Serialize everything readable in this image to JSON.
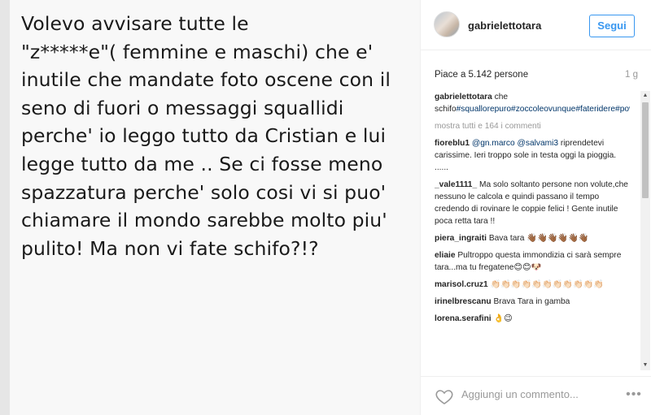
{
  "post": {
    "image_text": "Volevo avvisare tutte le\n\"z*****e\"( femmine e maschi) che e'\ninutile che mandate foto oscene con il\nseno di fuori o messaggi squallidi\nperche' io leggo tutto da Cristian e lui\nlegge tutto da me .. Se ci fosse meno\nspazzatura perche' solo cosi vi si puo'\nchiamare il mondo sarebbe molto piu'\npulito! Ma non vi fate schifo?!?"
  },
  "header": {
    "username": "gabrielettotara",
    "follow_label": "Segui",
    "accent": "#3897f0"
  },
  "likes": {
    "text": "Piace a 5.142 persone",
    "time": "1 g"
  },
  "caption": {
    "user": "gabrielettotara",
    "text_pre": "che schifo",
    "hashtags": "#squallorepuro#zoccoleovunque#fateridere#poverettevoi#poverettiii"
  },
  "show_all": "mostra tutti e 164 i commenti",
  "comments": [
    {
      "user": "fioreblu1",
      "mentions": "@gn.marco @salvami3",
      "text": "riprendetevi carissime. Ieri troppo sole in testa oggi la pioggia. ......"
    },
    {
      "user": "_vale1111_",
      "mentions": "",
      "text": "Ma solo soltanto persone non volute,che nessuno le calcola e quindi passano il tempo credendo di rovinare le coppie felici ! Gente inutile poca retta tara !!"
    },
    {
      "user": "piera_ingraiti",
      "mentions": "",
      "text": "Bava tara 👋🏾👋🏾👋🏾👋🏾👋🏾👋🏾"
    },
    {
      "user": "eliaie",
      "mentions": "",
      "text": "Pultroppo questa immondizia ci sarà sempre tara...ma tu fregatene😊😊🐶"
    },
    {
      "user": "marisol.cruz1",
      "mentions": "",
      "text": "👏🏻👏🏻👏🏻👏🏻👏🏻👏🏻👏🏻👏🏻👏🏻👏🏻👏🏻"
    },
    {
      "user": "irinelbrescanu",
      "mentions": "",
      "text": "Brava Tara in gamba"
    },
    {
      "user": "lorena.serafini",
      "mentions": "",
      "text": "👌😉"
    }
  ],
  "footer": {
    "comment_placeholder": "Aggiungi un commento...",
    "more_label": "•••"
  }
}
